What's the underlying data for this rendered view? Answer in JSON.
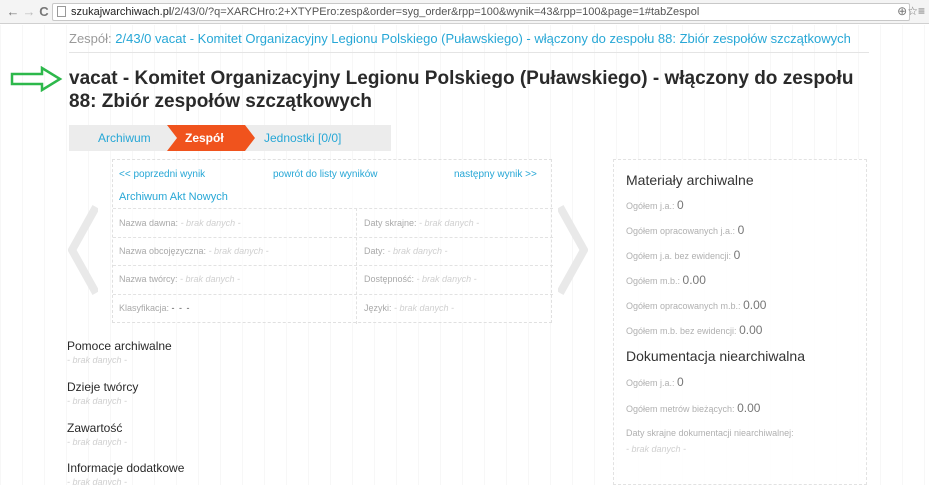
{
  "browser": {
    "back_icon": "←",
    "forward_icon": "→",
    "reload_icon": "C",
    "url_host": "szukajwarchiwach.pl",
    "url_path": "/2/43/0/?q=XARCHro:2+XTYPEro:zesp&order=syg_order&rpp=100&wynik=43&rpp=100&page=1#tabZespol",
    "right_icons": "⊕☆≡"
  },
  "breadcrumb": {
    "label": "Zespół:",
    "value": "2/43/0 vacat - Komitet Organizacyjny Legionu Polskiego (Puławskiego) - włączony do zespołu 88: Zbiór zespołów szczątkowych"
  },
  "title": "vacat - Komitet Organizacyjny Legionu Polskiego (Puławskiego) - włączony do zespołu 88: Zbiór zespołów szczątkowych",
  "colors": {
    "accent": "#27a7d6",
    "active_tab": "#f0531d",
    "arrow": "#2db84b"
  },
  "tabs": {
    "archiwum": "Archiwum",
    "zespol": "Zespół",
    "jednostki": "Jednostki [0/0]"
  },
  "info": {
    "prev": "<< poprzedni wynik",
    "back_to_list": "powrót do listy wyników",
    "next": "następny wynik >>",
    "archive": "Archiwum Akt Nowych",
    "fields": {
      "nazwa_dawna_label": "Nazwa dawna:",
      "nazwa_dawna_val": "- brak danych -",
      "daty_skrajne_label": "Daty skrajne:",
      "daty_skrajne_val": "- brak danych -",
      "nazwa_obcojezyczna_label": "Nazwa obcojęzyczna:",
      "nazwa_obcojezyczna_val": "- brak danych -",
      "daty_label": "Daty:",
      "daty_val": "- brak danych -",
      "nazwa_tworcy_label": "Nazwa twórcy:",
      "nazwa_tworcy_val": "- brak danych -",
      "dostepnosc_label": "Dostępność:",
      "dostepnosc_val": "- brak danych -",
      "klasyfikacja_label": "Klasyfikacja:",
      "klasyfikacja_val": "- - -",
      "jezyki_label": "Języki:",
      "jezyki_val": "- brak danych -"
    }
  },
  "sections": [
    {
      "title": "Pomoce archiwalne",
      "value": "- brak danych -"
    },
    {
      "title": "Dzieje twórcy",
      "value": "- brak danych -"
    },
    {
      "title": "Zawartość",
      "value": "- brak danych -"
    },
    {
      "title": "Informacje dodatkowe",
      "value": "- brak danych -"
    }
  ],
  "panel": {
    "materials_title": "Materiały archiwalne",
    "ogolem_ja_label": "Ogółem j.a.:",
    "ogolem_ja_val": "0",
    "opracowanych_ja_label": "Ogółem opracowanych j.a.:",
    "opracowanych_ja_val": "0",
    "bez_ewidencji_ja_label": "Ogółem j.a. bez ewidencji:",
    "bez_ewidencji_ja_val": "0",
    "ogolem_mb_label": "Ogółem m.b.:",
    "ogolem_mb_val": "0.00",
    "opracowanych_mb_label": "Ogółem opracowanych m.b.:",
    "opracowanych_mb_val": "0.00",
    "bez_ewidencji_mb_label": "Ogółem m.b. bez ewidencji:",
    "bez_ewidencji_mb_val": "0.00",
    "docs_title": "Dokumentacja niearchiwalna",
    "docs_ja_label": "Ogółem j.a.:",
    "docs_ja_val": "0",
    "docs_metrow_label": "Ogółem metrów bieżących:",
    "docs_metrow_val": "0.00",
    "docs_dates_label": "Daty skrajne dokumentacji niearchiwalnej:",
    "docs_dates_val": "- brak danych -"
  }
}
